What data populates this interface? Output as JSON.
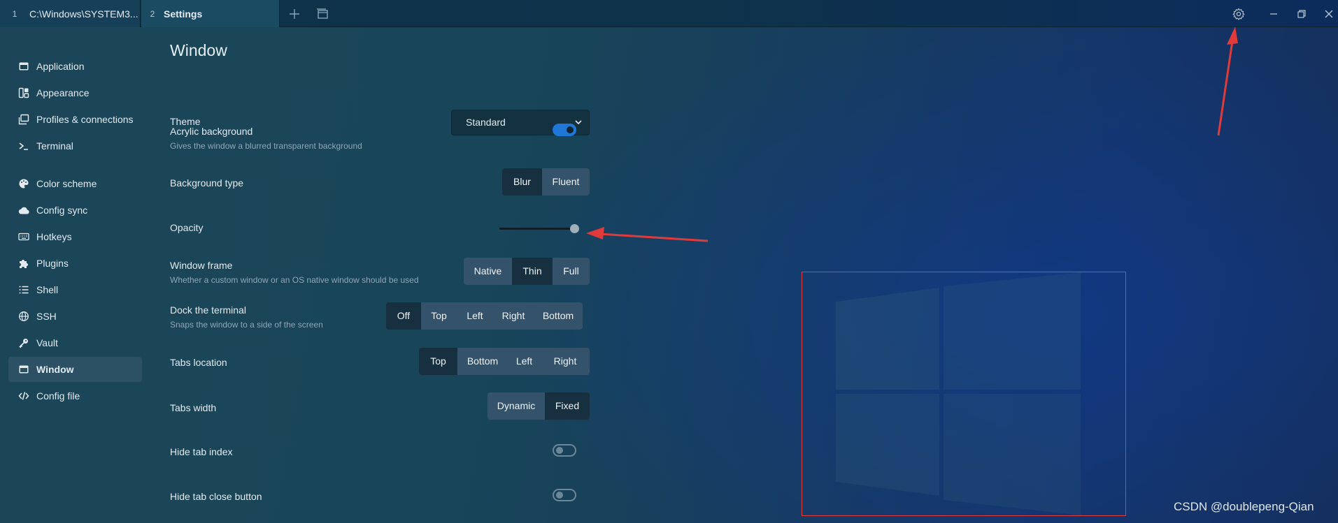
{
  "tabs": [
    {
      "index": "1",
      "title": "C:\\Windows\\SYSTEM3..."
    },
    {
      "index": "2",
      "title": "Settings"
    }
  ],
  "titlebar_icons": [
    "plus-icon",
    "window-icon",
    "gear-icon",
    "minimize-icon",
    "restore-icon",
    "close-icon"
  ],
  "sidebar": {
    "items": [
      {
        "label": "Application",
        "icon": "window-icon"
      },
      {
        "label": "Appearance",
        "icon": "palette-grid-icon"
      },
      {
        "label": "Profiles & connections",
        "icon": "windows-stack-icon"
      },
      {
        "label": "Terminal",
        "icon": "terminal-prompt-icon"
      },
      {
        "label": "Color scheme",
        "icon": "palette-icon"
      },
      {
        "label": "Config sync",
        "icon": "cloud-icon"
      },
      {
        "label": "Hotkeys",
        "icon": "keyboard-icon"
      },
      {
        "label": "Plugins",
        "icon": "puzzle-icon"
      },
      {
        "label": "Shell",
        "icon": "list-icon"
      },
      {
        "label": "SSH",
        "icon": "globe-icon"
      },
      {
        "label": "Vault",
        "icon": "key-icon"
      },
      {
        "label": "Window",
        "icon": "window-icon",
        "active": true
      },
      {
        "label": "Config file",
        "icon": "code-icon"
      }
    ]
  },
  "main": {
    "title": "Window",
    "theme": {
      "label": "Theme",
      "value": "Standard"
    },
    "acrylic": {
      "label": "Acrylic background",
      "desc": "Gives the window a blurred transparent background",
      "on": true
    },
    "background_type": {
      "label": "Background type",
      "options": [
        "Blur",
        "Fluent"
      ],
      "selected": "Blur"
    },
    "opacity": {
      "label": "Opacity",
      "value": 0.95
    },
    "window_frame": {
      "label": "Window frame",
      "desc": "Whether a custom window or an OS native window should be used",
      "options": [
        "Native",
        "Thin",
        "Full"
      ],
      "selected": "Thin"
    },
    "dock": {
      "label": "Dock the terminal",
      "desc": "Snaps the window to a side of the screen",
      "options": [
        "Off",
        "Top",
        "Left",
        "Right",
        "Bottom"
      ],
      "selected": "Off"
    },
    "tabs_location": {
      "label": "Tabs location",
      "options": [
        "Top",
        "Bottom",
        "Left",
        "Right"
      ],
      "selected": "Top"
    },
    "tabs_width": {
      "label": "Tabs width",
      "options": [
        "Dynamic",
        "Fixed"
      ],
      "selected": "Fixed"
    },
    "hide_tab_index": {
      "label": "Hide tab index",
      "on": false
    },
    "hide_tab_close": {
      "label": "Hide tab close button",
      "on": false
    }
  },
  "annotation_color": "#e03a3a",
  "watermark": "CSDN @doublepeng-Qian"
}
